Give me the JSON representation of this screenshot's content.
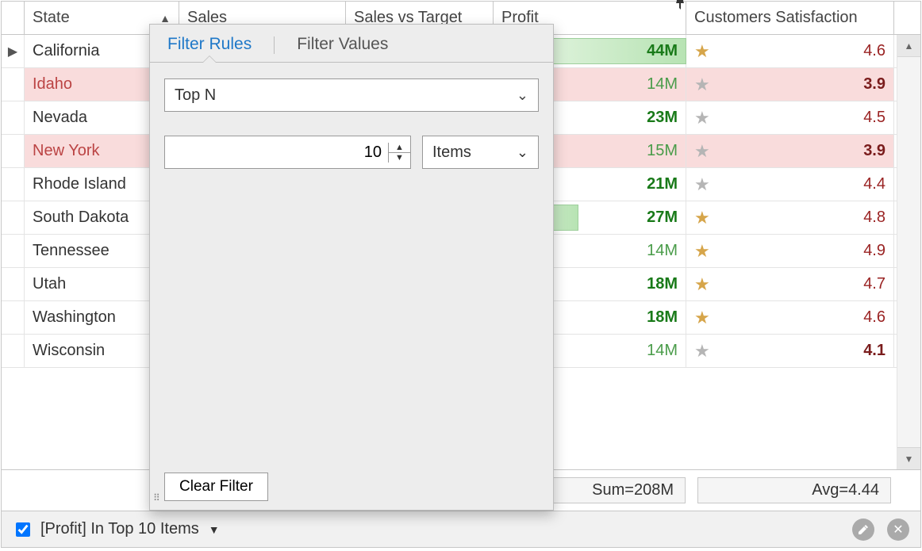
{
  "columns": {
    "state": "State",
    "sales": "Sales",
    "sales_vs_target": "Sales vs Target",
    "profit": "Profit",
    "cs": "Customers Satisfaction"
  },
  "rows": [
    {
      "state": "California",
      "profit": "44M",
      "profit_bold": true,
      "bar": 100,
      "cs": "4.6",
      "cs_bold": false,
      "star": "gold",
      "red": false,
      "indicator": true
    },
    {
      "state": "Idaho",
      "profit": "14M",
      "profit_bold": false,
      "bar": 0,
      "cs": "3.9",
      "cs_bold": true,
      "star": "gray",
      "red": true,
      "indicator": false
    },
    {
      "state": "Nevada",
      "profit": "23M",
      "profit_bold": true,
      "bar": 30,
      "cs": "4.5",
      "cs_bold": false,
      "star": "gray",
      "red": false,
      "indicator": false
    },
    {
      "state": "New York",
      "profit": "15M",
      "profit_bold": false,
      "bar": 4,
      "cs": "3.9",
      "cs_bold": true,
      "star": "gray",
      "red": true,
      "indicator": false
    },
    {
      "state": "Rhode Island",
      "profit": "21M",
      "profit_bold": true,
      "bar": 24,
      "cs": "4.4",
      "cs_bold": false,
      "star": "gray",
      "red": false,
      "indicator": false
    },
    {
      "state": "South Dakota",
      "profit": "27M",
      "profit_bold": true,
      "bar": 44,
      "cs": "4.8",
      "cs_bold": false,
      "star": "gold",
      "red": false,
      "indicator": false
    },
    {
      "state": "Tennessee",
      "profit": "14M",
      "profit_bold": false,
      "bar": 0,
      "cs": "4.9",
      "cs_bold": false,
      "star": "gold",
      "red": false,
      "indicator": false
    },
    {
      "state": "Utah",
      "profit": "18M",
      "profit_bold": true,
      "bar": 14,
      "cs": "4.7",
      "cs_bold": false,
      "star": "gold",
      "red": false,
      "indicator": false
    },
    {
      "state": "Washington",
      "profit": "18M",
      "profit_bold": true,
      "bar": 14,
      "cs": "4.6",
      "cs_bold": false,
      "star": "gold",
      "red": false,
      "indicator": false
    },
    {
      "state": "Wisconsin",
      "profit": "14M",
      "profit_bold": false,
      "bar": 0,
      "cs": "4.1",
      "cs_bold": true,
      "star": "gray",
      "red": false,
      "indicator": false
    }
  ],
  "footer": {
    "sum": "Sum=208M",
    "avg": "Avg=4.44"
  },
  "status": {
    "text": "[Profit] In Top 10 Items"
  },
  "popup": {
    "tab_rules": "Filter Rules",
    "tab_values": "Filter Values",
    "mode": "Top N",
    "count": "10",
    "unit": "Items",
    "clear": "Clear Filter"
  }
}
